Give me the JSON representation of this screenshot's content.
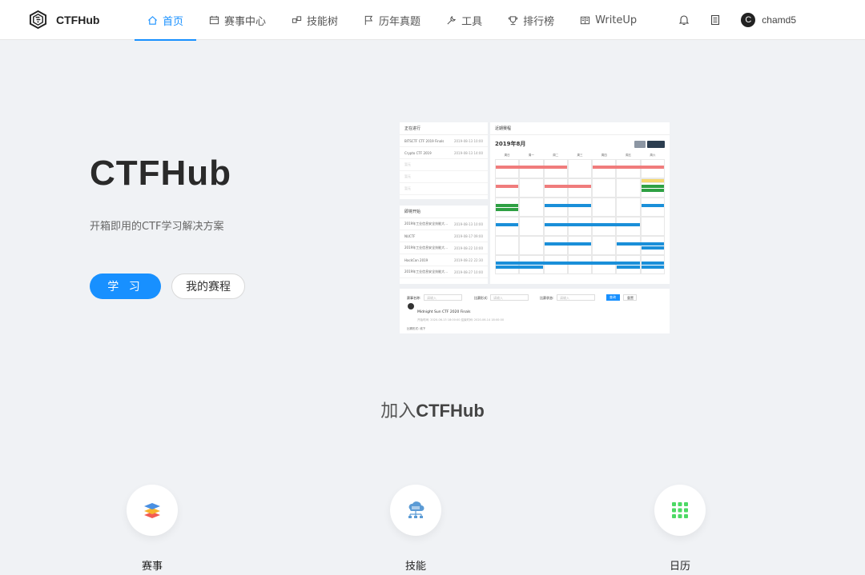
{
  "brand": {
    "name": "CTFHub"
  },
  "nav": {
    "items": [
      {
        "label": "首页",
        "icon": "home-icon",
        "active": true
      },
      {
        "label": "赛事中心",
        "icon": "calendar-icon"
      },
      {
        "label": "技能树",
        "icon": "skill-tree-icon"
      },
      {
        "label": "历年真题",
        "icon": "flag-icon"
      },
      {
        "label": "工具",
        "icon": "tool-icon"
      },
      {
        "label": "排行榜",
        "icon": "trophy-icon"
      },
      {
        "label": "WriteUp",
        "icon": "book-icon"
      }
    ],
    "user": {
      "initial": "C",
      "name": "chamd5"
    }
  },
  "hero": {
    "title": "CTFHub",
    "subtitle": "开箱即用的CTF学习解决方案",
    "primary_button": "学 习",
    "secondary_button": "我的赛程"
  },
  "preview": {
    "ongoing_title": "正在进行",
    "ongoing": [
      {
        "name": "BITSCTF CTF 2019 Finals",
        "date": "2019-08-13 10:00"
      },
      {
        "name": "Crypto CTF 2019",
        "date": "2019-08-13 14:00"
      },
      {
        "name": "暂无",
        "date": ""
      },
      {
        "name": "暂无",
        "date": ""
      },
      {
        "name": "暂无",
        "date": ""
      }
    ],
    "upcoming_title": "即将开始",
    "upcoming": [
      {
        "name": "2019年工业信息安全技能大...",
        "date": "2019-08-13 10:00"
      },
      {
        "name": "NUCTF",
        "date": "2019-08-17 09:00"
      },
      {
        "name": "2019年工业信息安全技能大...",
        "date": "2019-08-22 10:00"
      },
      {
        "name": "HackCon 2019",
        "date": "2019-08-22 22:30"
      },
      {
        "name": "2019年工业信息安全技能大...",
        "date": "2019-08-27 10:00"
      }
    ],
    "calendar_header": "近期赛程",
    "calendar_month": "2019年8月",
    "weekdays": [
      "周日",
      "周一",
      "周二",
      "周三",
      "周四",
      "周五",
      "周六"
    ],
    "filter_labels": [
      "赛事名称:",
      "比赛形式:",
      "比赛状态:"
    ],
    "filter_placeholder": "请输入",
    "search_button": "查询",
    "reset_button": "重置",
    "event_title": "Midnight Sun CTF 2020 Finals",
    "event_time": "开始时间: 2020-06-13 18:00:00  结束时间: 2020-06-14 18:00:00",
    "event_format": "比赛形式: 线下"
  },
  "join": {
    "prefix": "加入",
    "brand": "CTFHub"
  },
  "features": [
    {
      "label": "赛事",
      "icon": "layers-icon"
    },
    {
      "label": "技能",
      "icon": "cloud-network-icon"
    },
    {
      "label": "日历",
      "icon": "grid-dots-icon"
    }
  ],
  "colors": {
    "accent": "#1890ff",
    "calendar_red": "#f07c7c",
    "calendar_blue": "#1a8fd9",
    "calendar_green": "#2ea043",
    "calendar_yellow": "#f5d76e"
  }
}
